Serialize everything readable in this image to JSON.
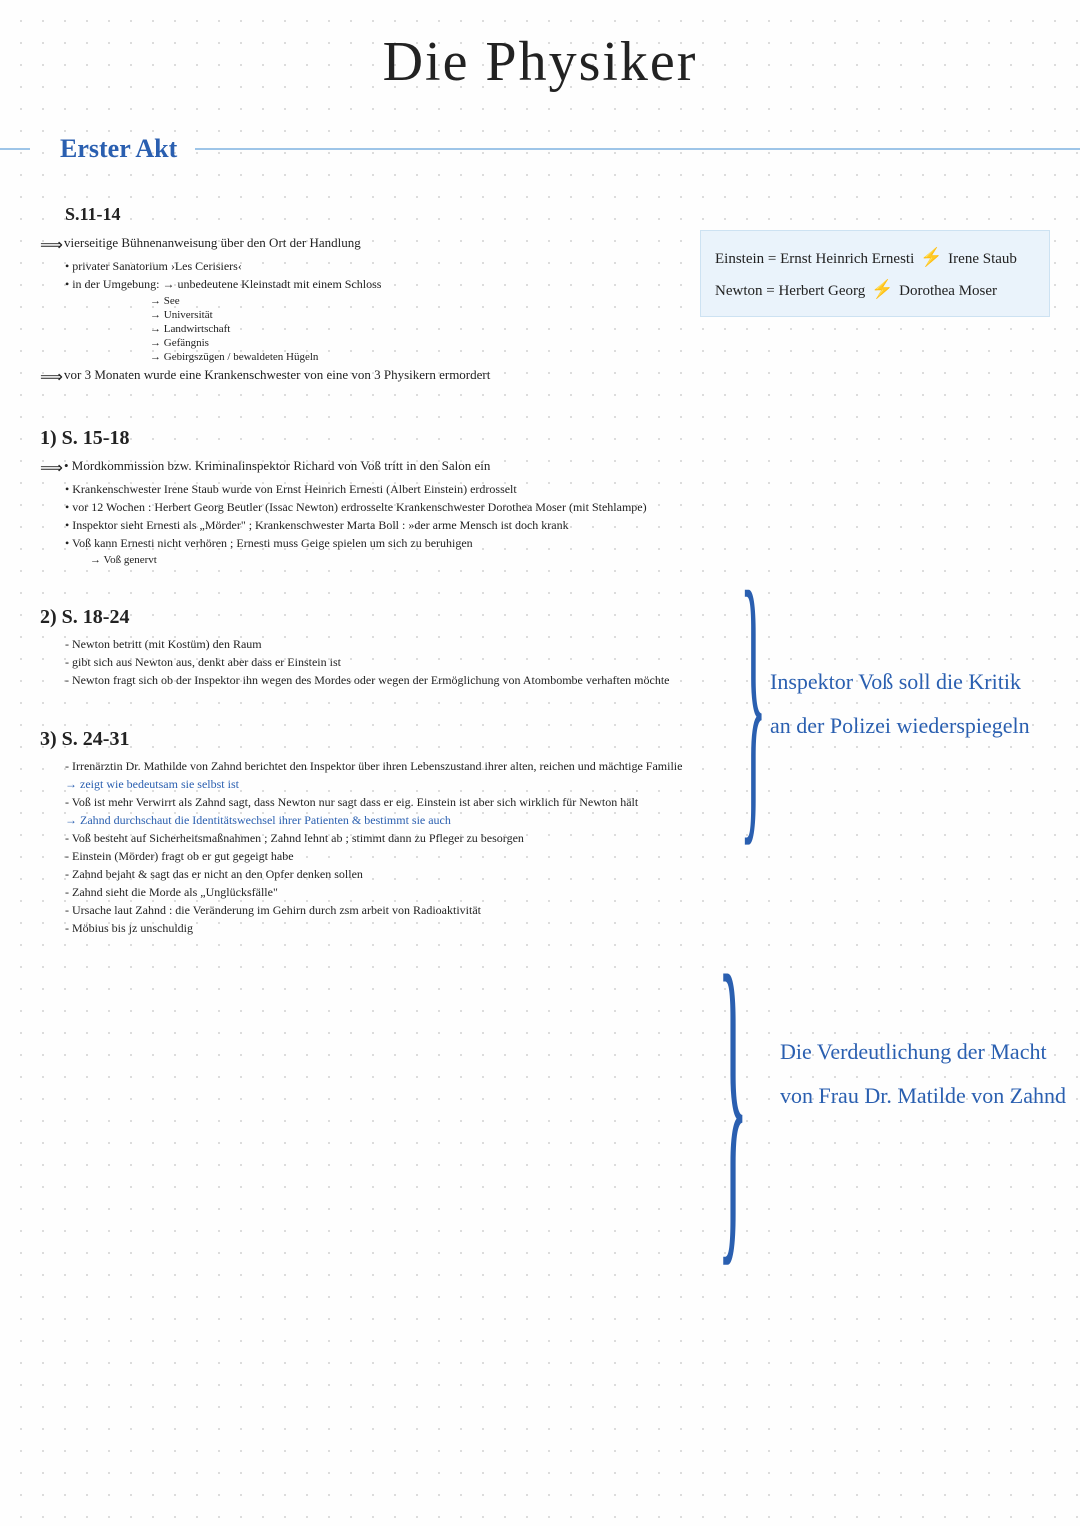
{
  "title": "Die Physiker",
  "act": "Erster Akt",
  "infobox": {
    "line1a": "Einstein = Ernst Heinrich Ernesti",
    "line1b": "Irene Staub",
    "line2a": "Newton  = Herbert Georg",
    "line2b": "Dorothea Moser"
  },
  "sec0": {
    "head": "S.11-14",
    "a1": "vierseitige Bühnenanweisung über den Ort der Handlung",
    "b1": "• privater Sanatorium ›Les Cerisiers‹",
    "b2": "• in der Umgebung:  → unbedeutene Kleinstadt mit einem Schloss",
    "s1": "→ See",
    "s2": "→ Universität",
    "s3": "→ Landwirtschaft",
    "s4": "→ Gefängnis",
    "s5": "→ Gebirgszügen / bewaldeten Hügeln",
    "a2": "vor 3 Monaten wurde eine Krankenschwester von eine von 3 Physikern ermordert"
  },
  "sec1": {
    "head": "1)   S. 15-18",
    "a1": "• Mordkommission bzw. Kriminalinspektor Richard von Voß tritt in den Salon ein",
    "l1": "• Krankenschwester Irene Staub wurde von Ernst Heinrich Ernesti (Albert Einstein) erdrosselt",
    "l2": "• vor 12 Wochen : Herbert Georg Beutler (Issac Newton) erdrosselte Krankenschwester Dorothea Moser (mit Stehlampe)",
    "l3": "• Inspektor sieht Ernesti als „Mörder\" ; Krankenschwester Marta Boll : »der arme Mensch ist doch krank",
    "l4": "• Voß kann Ernesti nicht verhören ; Ernesti muss Geige spielen um sich zu beruhigen",
    "l5": "→  Voß genervt"
  },
  "sec2": {
    "head": "2)   S. 18-24",
    "l1": "- Newton betritt (mit Kostüm) den Raum",
    "l2": "- gibt sich aus Newton aus, denkt aber dass er Einstein ist",
    "l3": "- Newton fragt sich ob der Inspektor ihn wegen des Mordes oder wegen der Ermöglichung von Atombombe verhaften möchte"
  },
  "sec3": {
    "head": "3)  S. 24-31",
    "l1": "- Irrenärztin Dr. Mathilde von Zahnd berichtet den Inspektor über ihren Lebenszustand ihrer alten, reichen und mächtige Familie",
    "l2": "→ zeigt wie bedeutsam sie selbst ist",
    "l3": "- Voß ist mehr Verwirrt als Zahnd sagt, dass Newton nur sagt dass er eig. Einstein ist aber sich wirklich für Newton hält",
    "l4": "→ Zahnd durchschaut die Identitätswechsel ihrer Patienten & bestimmt sie auch",
    "l5": "- Voß besteht auf Sicherheitsmaßnahmen ; Zahnd lehnt ab ; stimmt dann zu Pfleger zu besorgen",
    "l6": "- Einstein (Mörder) fragt ob er gut gegeigt habe",
    "l7": "- Zahnd bejaht & sagt das er nicht an den Opfer denken sollen",
    "l8": "- Zahnd sieht die Morde als „Unglücksfälle\"",
    "l9": "- Ursache laut Zahnd : die Veränderung im Gehirn durch zsm arbeit von Radioaktivität",
    "l10": "- Möbius bis jz unschuldig"
  },
  "sidenote1": {
    "l1": "Inspektor Voß soll die Kritik",
    "l2": "an der Polizei wiederspiegeln"
  },
  "sidenote2": {
    "l1": "Die Verdeutlichung der Macht",
    "l2": "von Frau Dr. Matilde von Zahnd"
  }
}
